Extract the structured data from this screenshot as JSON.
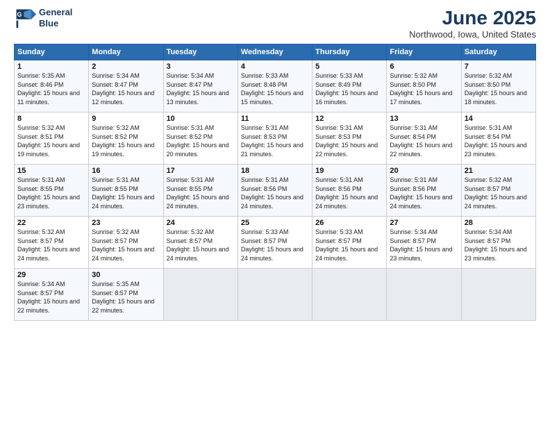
{
  "logo": {
    "line1": "General",
    "line2": "Blue"
  },
  "title": "June 2025",
  "location": "Northwood, Iowa, United States",
  "weekdays": [
    "Sunday",
    "Monday",
    "Tuesday",
    "Wednesday",
    "Thursday",
    "Friday",
    "Saturday"
  ],
  "weeks": [
    [
      {
        "day": "1",
        "sunrise": "5:35 AM",
        "sunset": "8:46 PM",
        "daylight": "15 hours and 11 minutes."
      },
      {
        "day": "2",
        "sunrise": "5:34 AM",
        "sunset": "8:47 PM",
        "daylight": "15 hours and 12 minutes."
      },
      {
        "day": "3",
        "sunrise": "5:34 AM",
        "sunset": "8:47 PM",
        "daylight": "15 hours and 13 minutes."
      },
      {
        "day": "4",
        "sunrise": "5:33 AM",
        "sunset": "8:48 PM",
        "daylight": "15 hours and 15 minutes."
      },
      {
        "day": "5",
        "sunrise": "5:33 AM",
        "sunset": "8:49 PM",
        "daylight": "15 hours and 16 minutes."
      },
      {
        "day": "6",
        "sunrise": "5:32 AM",
        "sunset": "8:50 PM",
        "daylight": "15 hours and 17 minutes."
      },
      {
        "day": "7",
        "sunrise": "5:32 AM",
        "sunset": "8:50 PM",
        "daylight": "15 hours and 18 minutes."
      }
    ],
    [
      {
        "day": "8",
        "sunrise": "5:32 AM",
        "sunset": "8:51 PM",
        "daylight": "15 hours and 19 minutes."
      },
      {
        "day": "9",
        "sunrise": "5:32 AM",
        "sunset": "8:52 PM",
        "daylight": "15 hours and 19 minutes."
      },
      {
        "day": "10",
        "sunrise": "5:31 AM",
        "sunset": "8:52 PM",
        "daylight": "15 hours and 20 minutes."
      },
      {
        "day": "11",
        "sunrise": "5:31 AM",
        "sunset": "8:53 PM",
        "daylight": "15 hours and 21 minutes."
      },
      {
        "day": "12",
        "sunrise": "5:31 AM",
        "sunset": "8:53 PM",
        "daylight": "15 hours and 22 minutes."
      },
      {
        "day": "13",
        "sunrise": "5:31 AM",
        "sunset": "8:54 PM",
        "daylight": "15 hours and 22 minutes."
      },
      {
        "day": "14",
        "sunrise": "5:31 AM",
        "sunset": "8:54 PM",
        "daylight": "15 hours and 23 minutes."
      }
    ],
    [
      {
        "day": "15",
        "sunrise": "5:31 AM",
        "sunset": "8:55 PM",
        "daylight": "15 hours and 23 minutes."
      },
      {
        "day": "16",
        "sunrise": "5:31 AM",
        "sunset": "8:55 PM",
        "daylight": "15 hours and 24 minutes."
      },
      {
        "day": "17",
        "sunrise": "5:31 AM",
        "sunset": "8:55 PM",
        "daylight": "15 hours and 24 minutes."
      },
      {
        "day": "18",
        "sunrise": "5:31 AM",
        "sunset": "8:56 PM",
        "daylight": "15 hours and 24 minutes."
      },
      {
        "day": "19",
        "sunrise": "5:31 AM",
        "sunset": "8:56 PM",
        "daylight": "15 hours and 24 minutes."
      },
      {
        "day": "20",
        "sunrise": "5:31 AM",
        "sunset": "8:56 PM",
        "daylight": "15 hours and 24 minutes."
      },
      {
        "day": "21",
        "sunrise": "5:32 AM",
        "sunset": "8:57 PM",
        "daylight": "15 hours and 24 minutes."
      }
    ],
    [
      {
        "day": "22",
        "sunrise": "5:32 AM",
        "sunset": "8:57 PM",
        "daylight": "15 hours and 24 minutes."
      },
      {
        "day": "23",
        "sunrise": "5:32 AM",
        "sunset": "8:57 PM",
        "daylight": "15 hours and 24 minutes."
      },
      {
        "day": "24",
        "sunrise": "5:32 AM",
        "sunset": "8:57 PM",
        "daylight": "15 hours and 24 minutes."
      },
      {
        "day": "25",
        "sunrise": "5:33 AM",
        "sunset": "8:57 PM",
        "daylight": "15 hours and 24 minutes."
      },
      {
        "day": "26",
        "sunrise": "5:33 AM",
        "sunset": "8:57 PM",
        "daylight": "15 hours and 24 minutes."
      },
      {
        "day": "27",
        "sunrise": "5:34 AM",
        "sunset": "8:57 PM",
        "daylight": "15 hours and 23 minutes."
      },
      {
        "day": "28",
        "sunrise": "5:34 AM",
        "sunset": "8:57 PM",
        "daylight": "15 hours and 23 minutes."
      }
    ],
    [
      {
        "day": "29",
        "sunrise": "5:34 AM",
        "sunset": "8:57 PM",
        "daylight": "15 hours and 22 minutes."
      },
      {
        "day": "30",
        "sunrise": "5:35 AM",
        "sunset": "8:57 PM",
        "daylight": "15 hours and 22 minutes."
      },
      null,
      null,
      null,
      null,
      null
    ]
  ]
}
